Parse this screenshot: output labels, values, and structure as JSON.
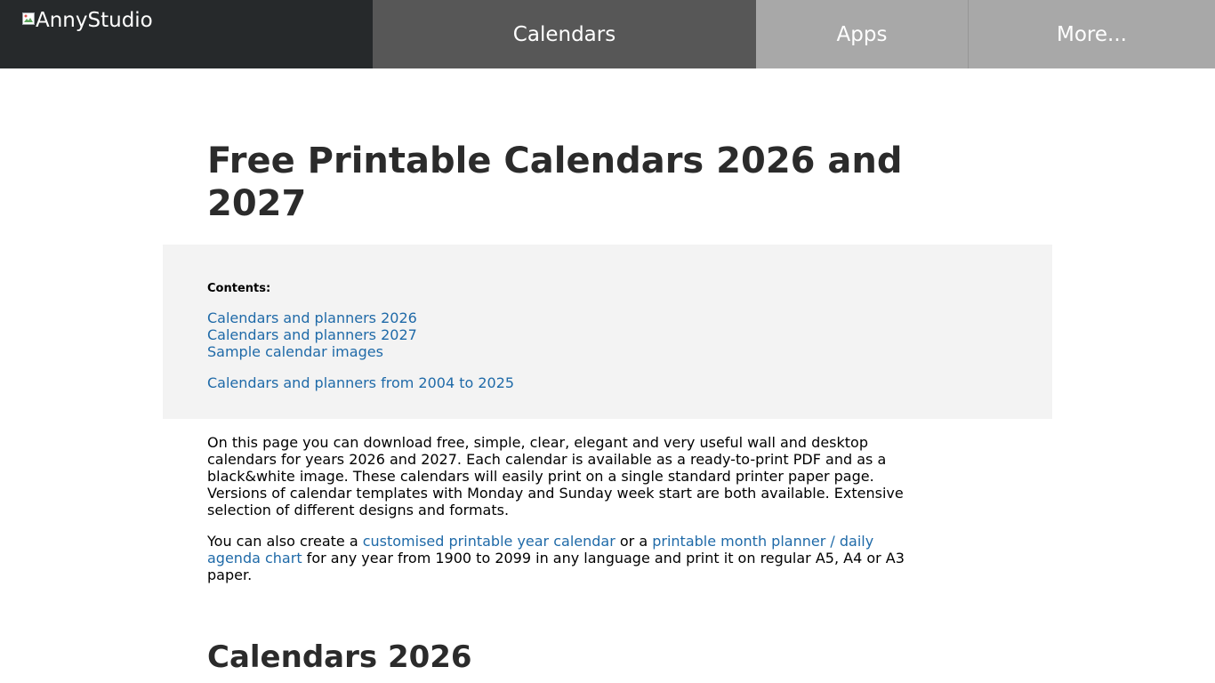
{
  "header": {
    "logo_alt": "AnnyStudio",
    "nav": [
      {
        "label": "Calendars",
        "active": true
      },
      {
        "label": "Apps"
      },
      {
        "label": "More..."
      }
    ]
  },
  "main": {
    "title": "Free Printable Calendars 2026 and 2027",
    "contents": {
      "label": "Contents:",
      "links": [
        "Calendars and planners 2026",
        "Calendars and planners 2027",
        "Sample calendar images"
      ],
      "archive_link": "Calendars and planners from 2004 to 2025"
    },
    "intro": "On this page you can download free, simple, clear, elegant and very useful wall and desktop calendars for years 2026 and 2027. Each calendar is available as a ready-to-print PDF and as a black&white image. These calendars will easily print on a single standard printer paper page. Versions of calendar templates with Monday and Sunday week start are both available. Extensive selection of different designs and formats.",
    "also": {
      "pre": "You can also create a ",
      "link1": "customised printable year calendar",
      "mid": " or a ",
      "link2": "printable month planner / daily agenda chart",
      "post": " for any year from 1900 to 2099 in any language and print it on regular A5, A4 or A3 paper."
    },
    "section_heading": "Calendars 2026"
  },
  "colors": {
    "header_dark": "#26292b",
    "nav_active": "#575757",
    "nav_inactive": "#a8a8a8",
    "link": "#1f6aa8",
    "contents_bg": "#f3f3f3"
  },
  "icons": {
    "logo": "broken-image-icon"
  }
}
